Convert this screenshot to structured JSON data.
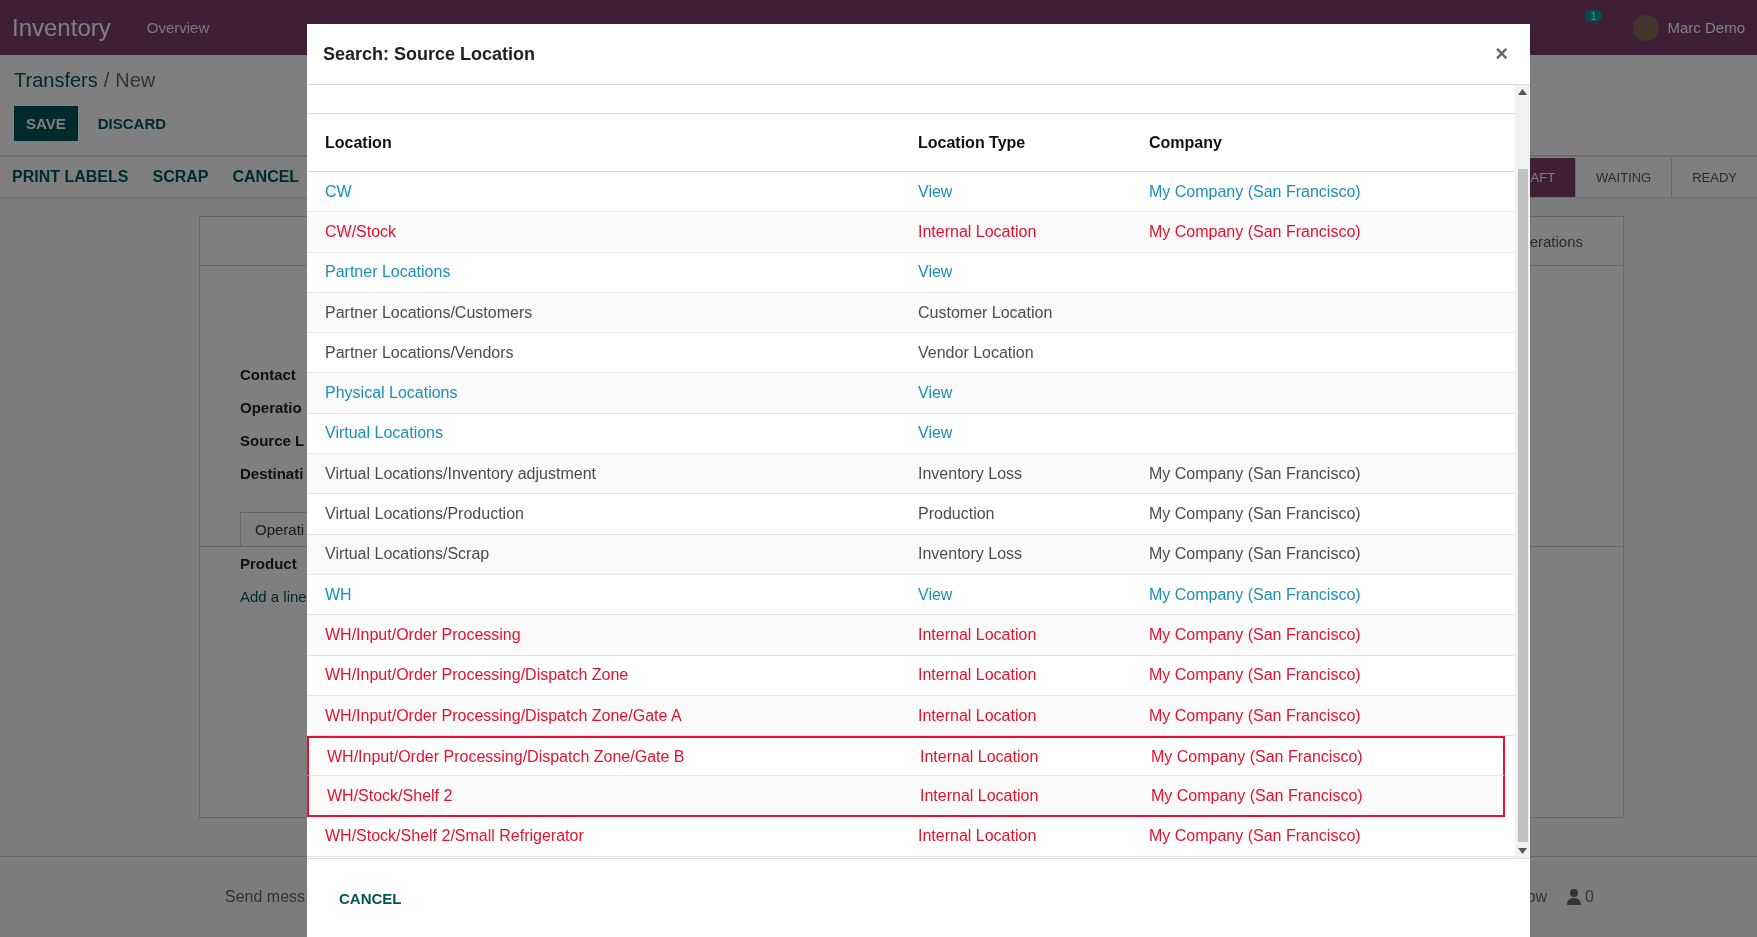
{
  "topbar": {
    "app_name": "Inventory",
    "menu": [
      "Overview"
    ],
    "notification_count": "1",
    "user": "Marc Demo"
  },
  "breadcrumb": {
    "parent": "Transfers",
    "separator": "/",
    "current": "New"
  },
  "buttons": [
    "SAVE",
    "DISCARD"
  ],
  "actions": [
    "PRINT LABELS",
    "SCRAP",
    "CANCEL"
  ],
  "status_steps": [
    {
      "label": "AFT",
      "selected": true
    },
    {
      "label": "WAITING",
      "selected": false
    },
    {
      "label": "READY",
      "selected": false
    }
  ],
  "form": {
    "tab_right": "erations",
    "fields": [
      "Contact",
      "Operatio",
      "Source L",
      "Destinati"
    ],
    "tab_left": "Operati",
    "column": "Product",
    "add_line": "Add a line"
  },
  "chatter": {
    "send": "Send mess",
    "follow": "ow",
    "followers": "0"
  },
  "dialog": {
    "title": "Search: Source Location",
    "close": "×",
    "columns": [
      "Location",
      "Location Type",
      "Company"
    ],
    "rows": [
      {
        "kind": "view",
        "location": "CW",
        "type": "View",
        "company": "My Company (San Francisco)",
        "highlighted": false
      },
      {
        "kind": "internal",
        "location": "CW/Stock",
        "type": "Internal Location",
        "company": "My Company (San Francisco)",
        "highlighted": false
      },
      {
        "kind": "view",
        "location": "Partner Locations",
        "type": "View",
        "highlighted": false
      },
      {
        "kind": "plain",
        "location": "Partner Locations/Customers",
        "type": "Customer Location",
        "highlighted": false
      },
      {
        "kind": "plain",
        "location": "Partner Locations/Vendors",
        "type": "Vendor Location",
        "highlighted": false
      },
      {
        "kind": "view",
        "location": "Physical Locations",
        "type": "View",
        "highlighted": false
      },
      {
        "kind": "view",
        "location": "Virtual Locations",
        "type": "View",
        "highlighted": false
      },
      {
        "kind": "plain",
        "location": "Virtual Locations/Inventory adjustment",
        "type": "Inventory Loss",
        "company": "My Company (San Francisco)",
        "highlighted": false
      },
      {
        "kind": "plain",
        "location": "Virtual Locations/Production",
        "type": "Production",
        "company": "My Company (San Francisco)",
        "highlighted": false
      },
      {
        "kind": "plain",
        "location": "Virtual Locations/Scrap",
        "type": "Inventory Loss",
        "company": "My Company (San Francisco)",
        "highlighted": false
      },
      {
        "kind": "view",
        "location": "WH",
        "type": "View",
        "company": "My Company (San Francisco)",
        "highlighted": false
      },
      {
        "kind": "internal",
        "location": "WH/Input/Order Processing",
        "type": "Internal Location",
        "company": "My Company (San Francisco)",
        "highlighted": false
      },
      {
        "kind": "internal",
        "location": "WH/Input/Order Processing/Dispatch Zone",
        "type": "Internal Location",
        "company": "My Company (San Francisco)",
        "highlighted": false
      },
      {
        "kind": "internal",
        "location": "WH/Input/Order Processing/Dispatch Zone/Gate A",
        "type": "Internal Location",
        "company": "My Company (San Francisco)",
        "highlighted": false
      },
      {
        "kind": "internal",
        "location": "WH/Input/Order Processing/Dispatch Zone/Gate B",
        "type": "Internal Location",
        "company": "My Company (San Francisco)",
        "highlighted": true
      },
      {
        "kind": "internal",
        "location": "WH/Stock/Shelf 2",
        "type": "Internal Location",
        "company": "My Company (San Francisco)",
        "highlighted": true
      },
      {
        "kind": "internal",
        "location": "WH/Stock/Shelf 2/Small Refrigerator",
        "type": "Internal Location",
        "company": "My Company (San Francisco)",
        "highlighted": false
      }
    ],
    "cancel": "CANCEL"
  }
}
